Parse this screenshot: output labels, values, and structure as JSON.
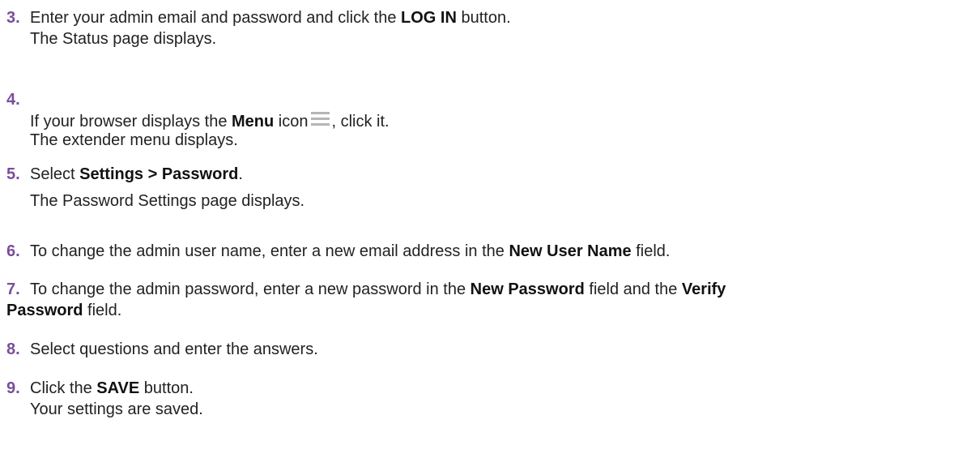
{
  "colors": {
    "step_number": "#7a4d9c",
    "text": "#222222"
  },
  "steps": [
    {
      "number": "3.",
      "line1": {
        "pre": "Enter your admin email and password and click the ",
        "bold": "LOG IN",
        "post": " button."
      },
      "line2": "The Status page displays."
    },
    {
      "number": "4.",
      "line1": {
        "pre": "If your browser displays the ",
        "bold": "Menu",
        "mid": " icon",
        "post": ", click it."
      },
      "line2": "The extender menu displays.",
      "icon": "menu-icon"
    },
    {
      "number": "5.",
      "line1": {
        "pre": "Select ",
        "bold": "Settings > Password",
        "post": "."
      },
      "line2": "The Password Settings page displays."
    },
    {
      "number": "6.",
      "line1": {
        "pre": "To change the admin user name, enter a new email address in the ",
        "bold": "New User Name",
        "post": " field."
      }
    },
    {
      "number": "7.",
      "line1": {
        "pre": "To change the admin password, enter a new password in the ",
        "bold": "New Password",
        "mid": " field and the ",
        "bold2": "Verify"
      },
      "line2": {
        "bold": "Password",
        "post": " field."
      }
    },
    {
      "number": "8.",
      "line1": "Select questions and enter the answers."
    },
    {
      "number": "9.",
      "line1": {
        "pre": "Click the ",
        "bold": "SAVE",
        "post": " button."
      },
      "line2": "Your settings are saved."
    }
  ]
}
